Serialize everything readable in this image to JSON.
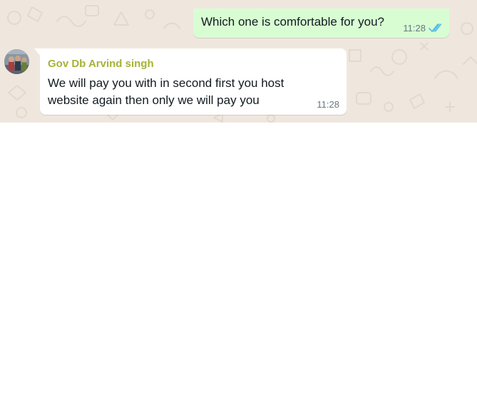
{
  "chat": {
    "background_color": "#efe7de",
    "outgoing": {
      "text": "Which one is comfortable for you?",
      "time": "11:28",
      "status_icon": "double-check-read-icon",
      "bubble_color": "#d9fdd3",
      "tick_color": "#53bdeb"
    },
    "incoming": {
      "sender": "Gov Db Arvind singh",
      "sender_color": "#a5b336",
      "text": "We will pay you with in second first you host website again then only we will pay you",
      "time": "11:28",
      "avatar_icon": "contact-avatar"
    }
  }
}
